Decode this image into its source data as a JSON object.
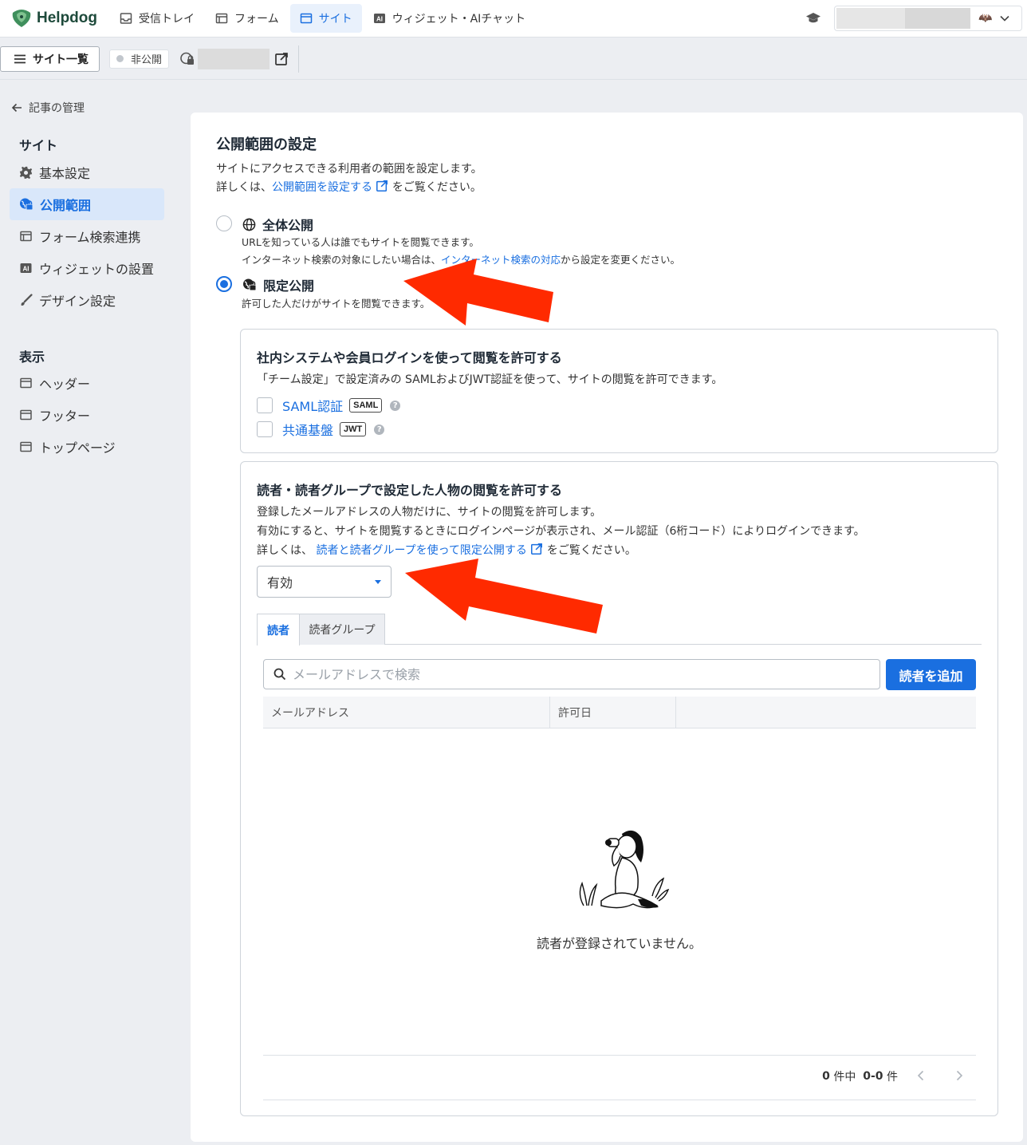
{
  "topbar": {
    "logo_text": "Helpdog",
    "nav": [
      {
        "label": "受信トレイ",
        "icon": "inbox-icon"
      },
      {
        "label": "フォーム",
        "icon": "form-icon"
      },
      {
        "label": "サイト",
        "icon": "site-icon",
        "active": true
      },
      {
        "label": "ウィジェット・AIチャット",
        "icon": "ai-icon"
      }
    ]
  },
  "subbar": {
    "site_list_label": "サイト一覧",
    "status_label": "非公開"
  },
  "sidebar": {
    "back_label": "記事の管理",
    "section_site": "サイト",
    "site_items": [
      "基本設定",
      "公開範囲",
      "フォーム検索連携",
      "ウィジェットの設置",
      "デザイン設定"
    ],
    "section_display": "表示",
    "display_items": [
      "ヘッダー",
      "フッター",
      "トップページ"
    ]
  },
  "main": {
    "title": "公開範囲の設定",
    "desc_line1": "サイトにアクセスできる利用者の範囲を設定します。",
    "desc_line2_pre": "詳しくは、",
    "desc_line2_link": "公開範囲を設定する",
    "desc_line2_post": "をご覧ください。",
    "option_public": {
      "title": "全体公開",
      "desc1": "URLを知っている人は誰でもサイトを閲覧できます。",
      "desc2_pre": "インターネット検索の対象にしたい場合は、",
      "desc2_link": "インターネット検索の対応",
      "desc2_post": "から設定を変更ください。"
    },
    "option_limited": {
      "title": "限定公開",
      "desc": "許可した人だけがサイトを閲覧できます。"
    },
    "box_sso": {
      "title": "社内システムや会員ログインを使って閲覧を許可する",
      "desc": "「チーム設定」で設定済みの SAMLおよびJWT認証を使って、サイトの閲覧を許可できます。",
      "saml_label": "SAML認証",
      "saml_tag": "SAML",
      "jwt_label": "共通基盤",
      "jwt_tag": "JWT",
      "help": "?"
    },
    "box_readers": {
      "title": "読者・読者グループで設定した人物の閲覧を許可する",
      "desc1": "登録したメールアドレスの人物だけに、サイトの閲覧を許可します。",
      "desc2": "有効にすると、サイトを閲覧するときにログインページが表示され、メール認証（6桁コード）によりログインできます。",
      "desc3_pre": "詳しくは、",
      "desc3_link": "読者と読者グループを使って限定公開する",
      "desc3_post": "をご覧ください。",
      "select_value": "有効",
      "tab_readers": "読者",
      "tab_groups": "読者グループ",
      "search_placeholder": "メールアドレスで検索",
      "add_button": "読者を追加",
      "col_email": "メールアドレス",
      "col_date": "許可日",
      "empty_text": "読者が登録されていません。",
      "pager_total": "0",
      "pager_mid": "件中",
      "pager_range": "0-0",
      "pager_unit": "件"
    }
  },
  "colors": {
    "accent": "#1a6fe0",
    "annotation_arrow": "#ff2a00"
  }
}
